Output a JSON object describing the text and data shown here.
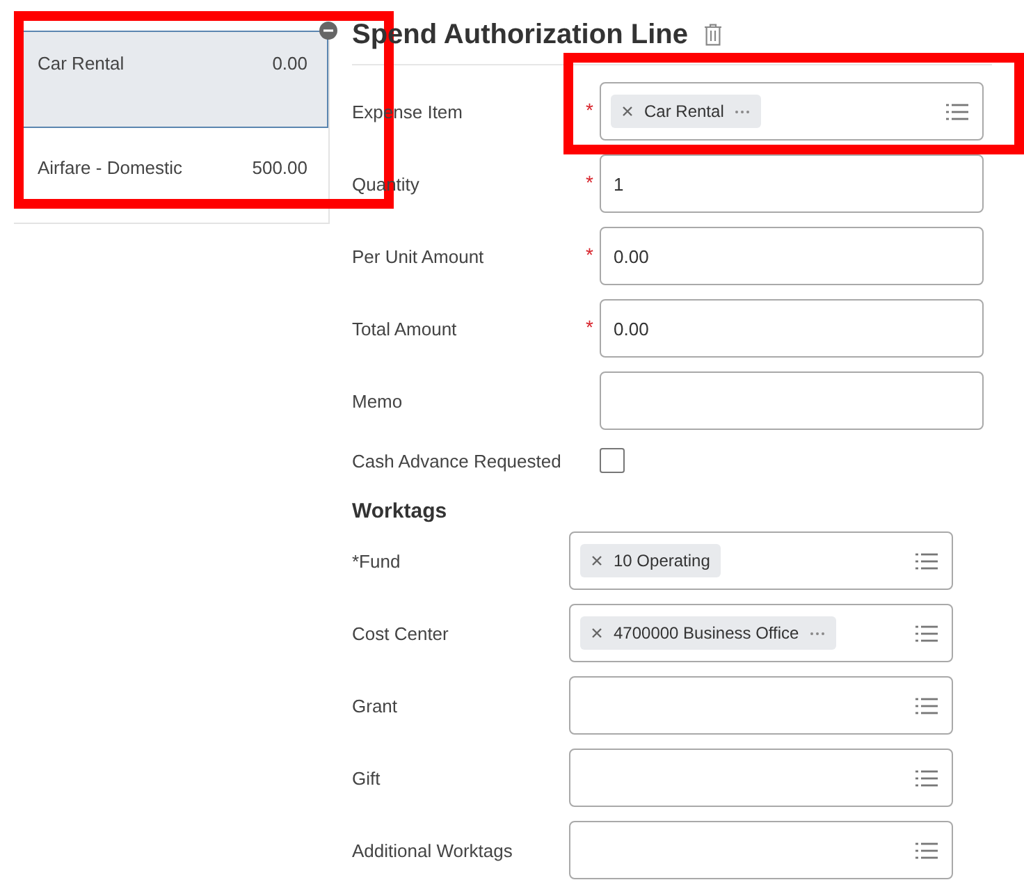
{
  "line_items": [
    {
      "name": "Car Rental",
      "amount": "0.00",
      "selected": true
    },
    {
      "name": "Airfare - Domestic",
      "amount": "500.00",
      "selected": false
    }
  ],
  "title": "Spend Authorization Line",
  "fields": [
    {
      "label": "Expense Item",
      "required_mark": "*",
      "kind": "prompt",
      "chips": [
        {
          "text": "Car Rental",
          "more": true
        }
      ]
    },
    {
      "label": "Quantity",
      "required_mark": "*",
      "kind": "text",
      "value": "1"
    },
    {
      "label": "Per Unit Amount",
      "required_mark": "*",
      "kind": "text",
      "value": "0.00"
    },
    {
      "label": "Total Amount",
      "required_mark": "*",
      "kind": "text",
      "value": "0.00"
    },
    {
      "label": "Memo",
      "kind": "text"
    },
    {
      "label": "Cash Advance Requested",
      "kind": "checkbox",
      "checked": false
    }
  ],
  "worktags": {
    "heading": "Worktags",
    "fields": [
      {
        "label": "*Fund",
        "chips": [
          {
            "text": "10 Operating",
            "more": false
          }
        ]
      },
      {
        "label": "Cost Center",
        "chips": [
          {
            "text": "4700000 Business Office",
            "more": true
          }
        ]
      },
      {
        "label": "Grant"
      },
      {
        "label": "Gift"
      },
      {
        "label": "Additional Worktags"
      }
    ]
  }
}
